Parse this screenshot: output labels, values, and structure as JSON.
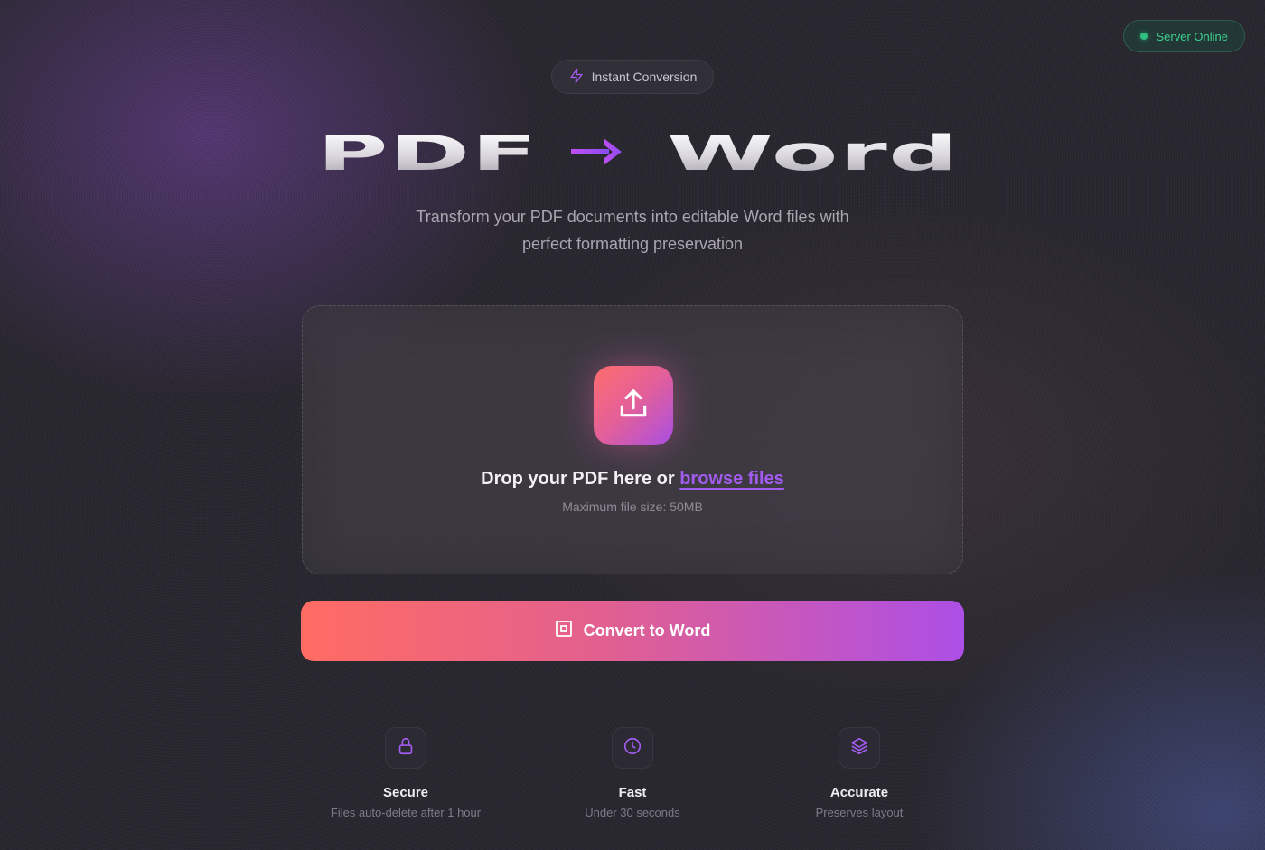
{
  "status": {
    "label": "Server Online",
    "color": "#2fbf7f"
  },
  "badge": {
    "label": "Instant Conversion",
    "icon": "lightning-icon"
  },
  "headline": {
    "left": "PDF",
    "right": "Word",
    "arrow_icon": "arrow-right-icon",
    "accent": "#a94fe3"
  },
  "subtitle": "Transform your PDF documents into editable Word files with perfect formatting preservation",
  "dropzone": {
    "icon": "upload-icon",
    "prompt": "Drop your PDF here or ",
    "browse_label": "browse files",
    "max_size": "Maximum file size: 50MB"
  },
  "convert_button": {
    "label": "Convert to Word",
    "icon": "document-icon"
  },
  "features": [
    {
      "icon": "lock-icon",
      "title": "Secure",
      "subtitle": "Files auto-delete after 1 hour"
    },
    {
      "icon": "clock-icon",
      "title": "Fast",
      "subtitle": "Under 30 seconds"
    },
    {
      "icon": "layers-icon",
      "title": "Accurate",
      "subtitle": "Preserves layout"
    }
  ]
}
